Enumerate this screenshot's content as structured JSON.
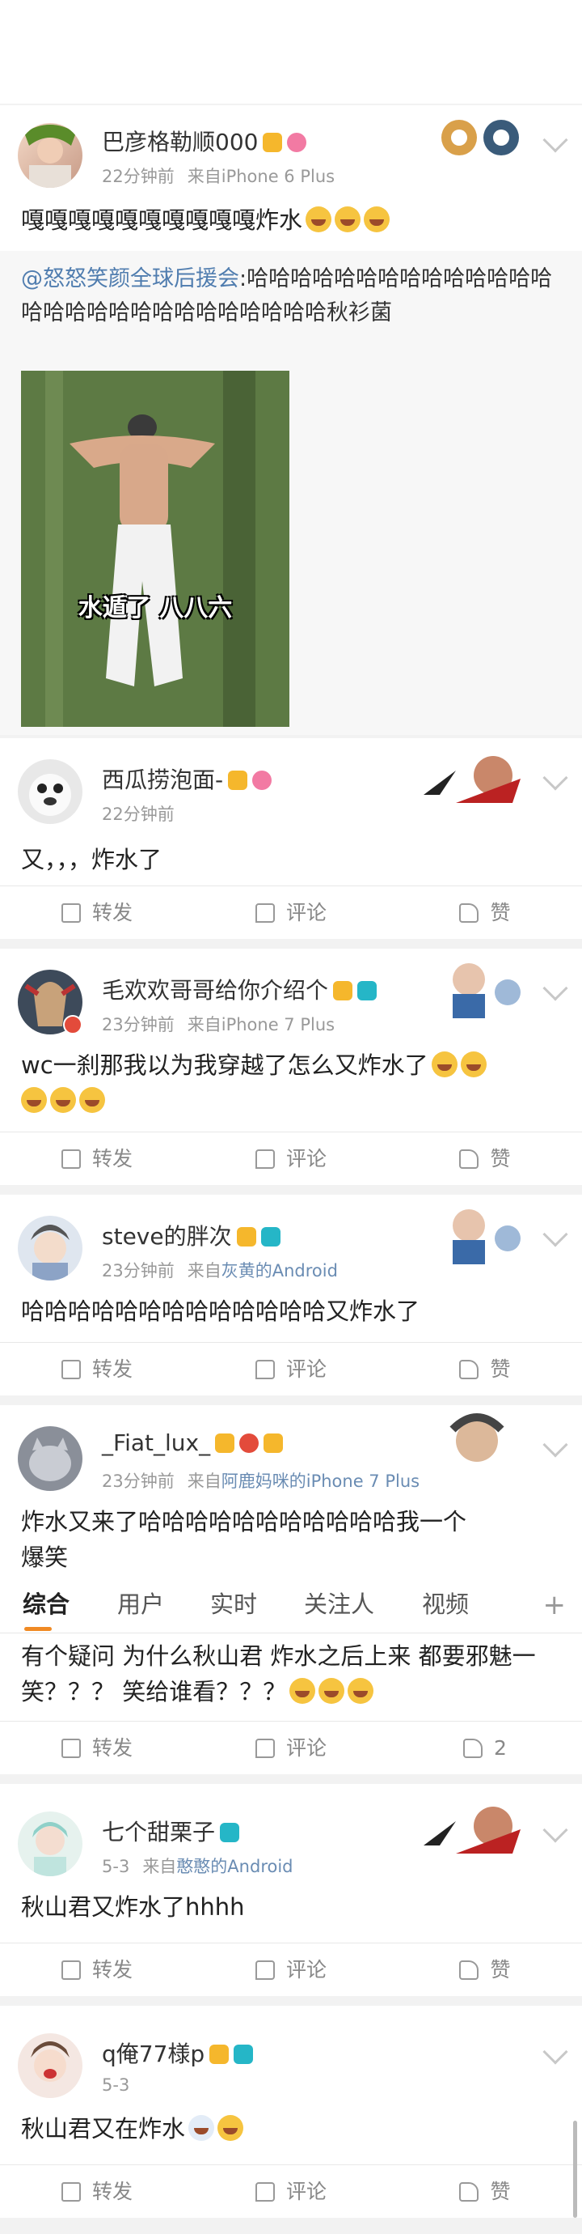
{
  "posts": [
    {
      "username": "巴彦格勒顺000",
      "time": "22分钟前",
      "source_prefix": "来自",
      "device": "iPhone 6 Plus",
      "content": "嘎嘎嘎嘎嘎嘎嘎嘎嘎嘎炸水",
      "quote_at": "@怒怒笑颜全球后援会",
      "quote_text": ":哈哈哈哈哈哈哈哈哈哈哈哈哈哈哈哈哈哈哈哈哈哈哈哈哈哈哈哈秋衫菌",
      "image_caption": "水遁了 八八六"
    },
    {
      "username": "西瓜捞泡面-",
      "time": "22分钟前",
      "content": "又，，，炸水了"
    },
    {
      "username": "毛欢欢哥哥给你介绍个",
      "time": "23分钟前",
      "source_prefix": "来自",
      "device": "iPhone 7 Plus",
      "content": "wc一刹那我以为我穿越了怎么又炸水了"
    },
    {
      "username": "steve的胖次",
      "time": "23分钟前",
      "source_prefix": "来自",
      "device": "灰黄的Android",
      "content": "哈哈哈哈哈哈哈哈哈哈哈哈哈又炸水了"
    },
    {
      "username": "_Fiat_lux_",
      "time": "23分钟前",
      "source_prefix": "来自",
      "device": "阿鹿妈咪的iPhone 7 Plus",
      "content_line1": "炸水又来了哈哈哈哈哈哈哈哈哈哈哈我一个",
      "content_line2": "爆笑"
    },
    {
      "content_line1": "有个疑问 为什么秋山君 炸水之后上来 都要邪魅一",
      "content_line2": "笑？？？ 笑给谁看？？？",
      "like_count": "2"
    },
    {
      "username": "七个甜栗子",
      "time": "5-3",
      "source_prefix": "来自",
      "device": "憨憨的Android",
      "content": "秋山君又炸水了hhhh"
    },
    {
      "username": "q俺77様p",
      "time": "5-3",
      "content": "秋山君又在炸水"
    }
  ],
  "actions": {
    "repost": "转发",
    "comment": "评论",
    "like": "赞"
  },
  "tabs": [
    "综合",
    "用户",
    "实时",
    "关注人",
    "视频"
  ],
  "plus": "+"
}
